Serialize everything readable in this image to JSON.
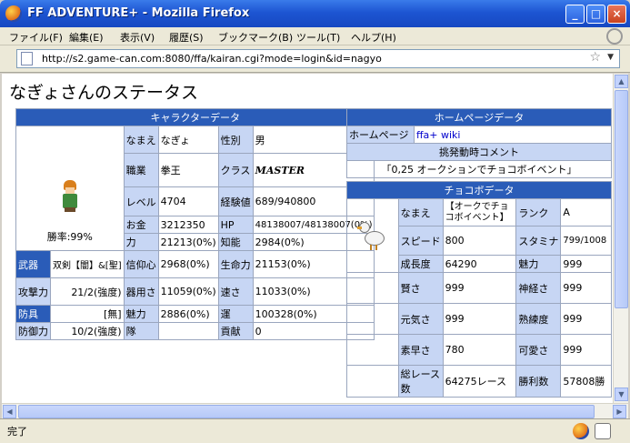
{
  "window": {
    "title": "FF ADVENTURE+ - Mozilla Firefox",
    "min": "_",
    "max": "□",
    "close": "×"
  },
  "menu": [
    "ファイル(F)",
    "編集(E)",
    "表示(V)",
    "履歴(S)",
    "ブックマーク(B)",
    "ツール(T)",
    "ヘルプ(H)"
  ],
  "url": "http://s2.game-can.com:8080/ffa/kairan.cgi?mode=login&id=nagyo",
  "status": "完了",
  "page_title": "なぎょさんのステータス",
  "char": {
    "header": "キャラクターデータ",
    "win_rate": "勝率:99%",
    "name_l": "なまえ",
    "name_v": "なぎょ",
    "sex_l": "性別",
    "sex_v": "男",
    "job_l": "職業",
    "job_v": "拳王",
    "class_l": "クラス",
    "class_v": "MASTER",
    "level_l": "レベル",
    "level_v": "4704",
    "exp_l": "経験値",
    "exp_v": "689/940800",
    "money_l": "お金",
    "money_v": "3212350",
    "hp_l": "HP",
    "hp_v": "48138007/48138007(0%)",
    "str_l": "力",
    "str_v": "21213(0%)",
    "int_l": "知能",
    "int_v": "2984(0%)",
    "weapon_l": "武器",
    "weapon_v": "双剣【闇】&[聖]",
    "faith_l": "信仰心",
    "faith_v": "2968(0%)",
    "vit_l": "生命力",
    "vit_v": "21153(0%)",
    "atk_l": "攻撃力",
    "atk_v": "21/2(強度)",
    "dex_l": "器用さ",
    "dex_v": "11059(0%)",
    "spd_l": "速さ",
    "spd_v": "11033(0%)",
    "armor_l": "防具",
    "armor_v": "[無]",
    "cha_l": "魅力",
    "cha_v": "2886(0%)",
    "luck_l": "運",
    "luck_v": "100328(0%)",
    "def_l": "防御力",
    "def_v": "10/2(強度)",
    "party_l": "隊",
    "party_v": "",
    "contrib_l": "貢献",
    "contrib_v": "0"
  },
  "home": {
    "header": "ホームページデータ",
    "hp_l": "ホームページ",
    "hp_v": "ffa+ wiki",
    "comment_l": "挑発動時コメント",
    "comment_v": "「0,25 オークションでチョコボイベント」"
  },
  "choco": {
    "header": "チョコボデータ",
    "name_l": "なまえ",
    "name_v": "【オークでチョコボイベント】",
    "rank_l": "ランク",
    "rank_v": "A",
    "spd_l": "スピード",
    "spd_v": "800",
    "sta_l": "スタミナ",
    "sta_v": "799/1008",
    "grow_l": "成長度",
    "grow_v": "64290",
    "cha_l": "魅力",
    "cha_v": "999",
    "wis_l": "賢さ",
    "wis_v": "999",
    "nerve_l": "神経さ",
    "nerve_v": "999",
    "vigor_l": "元気さ",
    "vigor_v": "999",
    "skill_l": "熟練度",
    "skill_v": "999",
    "quick_l": "素早さ",
    "quick_v": "780",
    "cute_l": "可愛さ",
    "cute_v": "999",
    "races_l": "総レース数",
    "races_v": "64275レース",
    "wins_l": "勝利数",
    "wins_v": "57808勝"
  }
}
